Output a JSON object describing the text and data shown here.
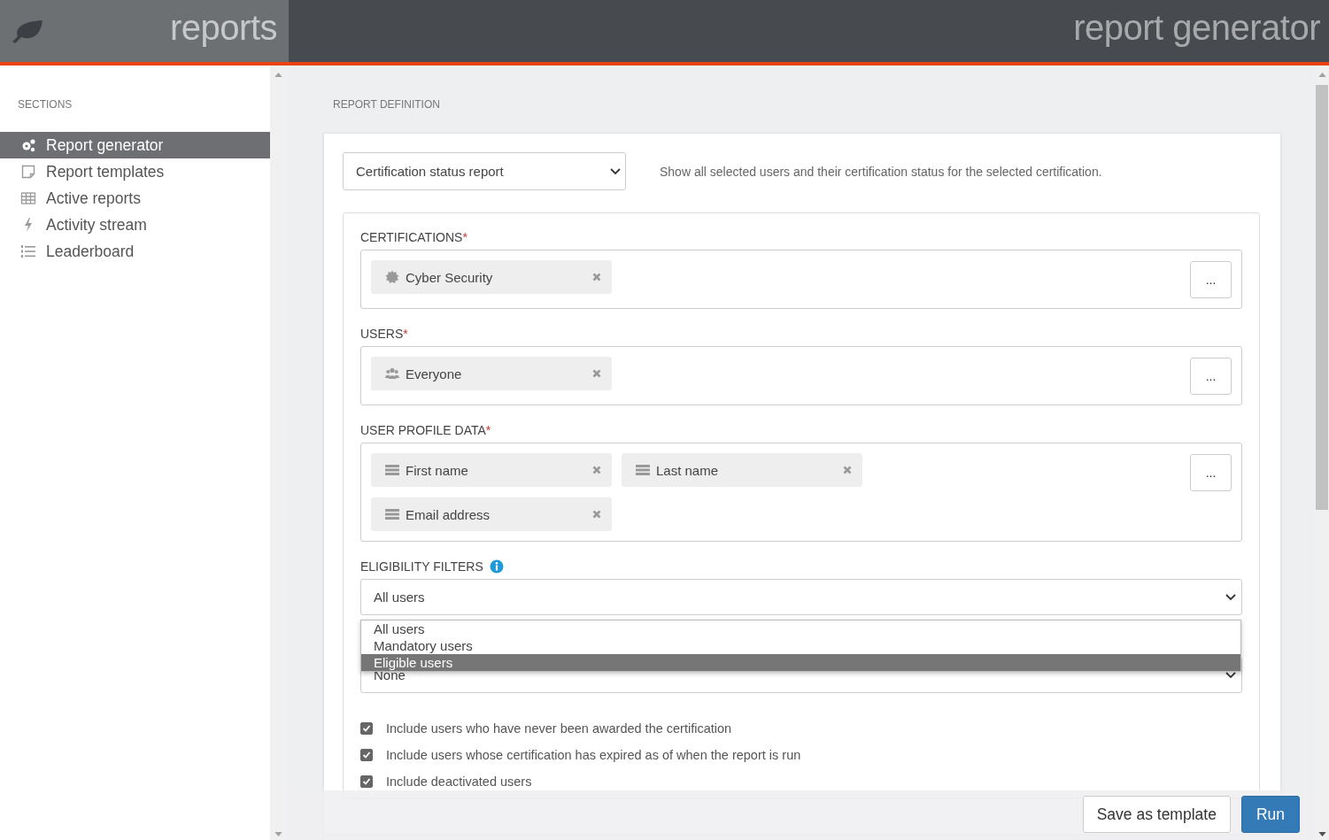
{
  "header": {
    "brand": "reports",
    "title": "report generator"
  },
  "sidebar": {
    "heading": "SECTIONS",
    "items": [
      {
        "label": "Report generator",
        "kind": "gears",
        "selected": true
      },
      {
        "label": "Report templates",
        "kind": "note",
        "selected": false
      },
      {
        "label": "Active reports",
        "kind": "table",
        "selected": false
      },
      {
        "label": "Activity stream",
        "kind": "bolt",
        "selected": false
      },
      {
        "label": "Leaderboard",
        "kind": "list",
        "selected": false
      }
    ]
  },
  "main": {
    "heading": "REPORT DEFINITION",
    "report_type": {
      "value": "Certification status report"
    },
    "description": "Show all selected users and their certification status for the selected certification.",
    "fields": [
      {
        "label": "CERTIFICATIONS",
        "required_mark": "*",
        "chips": [
          {
            "label": "Cyber Security",
            "kind": "badge"
          }
        ],
        "more": "..."
      },
      {
        "label": "USERS",
        "required_mark": "*",
        "chips": [
          {
            "label": "Everyone",
            "kind": "users"
          }
        ],
        "more": "..."
      },
      {
        "label": "USER PROFILE DATA",
        "required_mark": "*",
        "chips": [
          {
            "label": "First name",
            "kind": "rows"
          },
          {
            "label": "Last name",
            "kind": "rows"
          },
          {
            "label": "Email address",
            "kind": "rows"
          }
        ],
        "more": "..."
      }
    ],
    "eligibility": {
      "label": "ELIGIBILITY FILTERS",
      "value": "All users",
      "options": [
        {
          "label": "All users",
          "highlighted": false
        },
        {
          "label": "Mandatory users",
          "highlighted": false
        },
        {
          "label": "Eligible users",
          "highlighted": true
        }
      ]
    },
    "second_select": {
      "value": "None"
    },
    "checkboxes": [
      {
        "label": "Include users who have never been awarded the certification",
        "checked": true
      },
      {
        "label": "Include users whose certification has expired as of when the report is run",
        "checked": true
      },
      {
        "label": "Include deactivated users",
        "checked": true
      }
    ],
    "buttons": [
      {
        "label": "Save as template",
        "kind": "default"
      },
      {
        "label": "Run",
        "kind": "primary"
      }
    ]
  }
}
